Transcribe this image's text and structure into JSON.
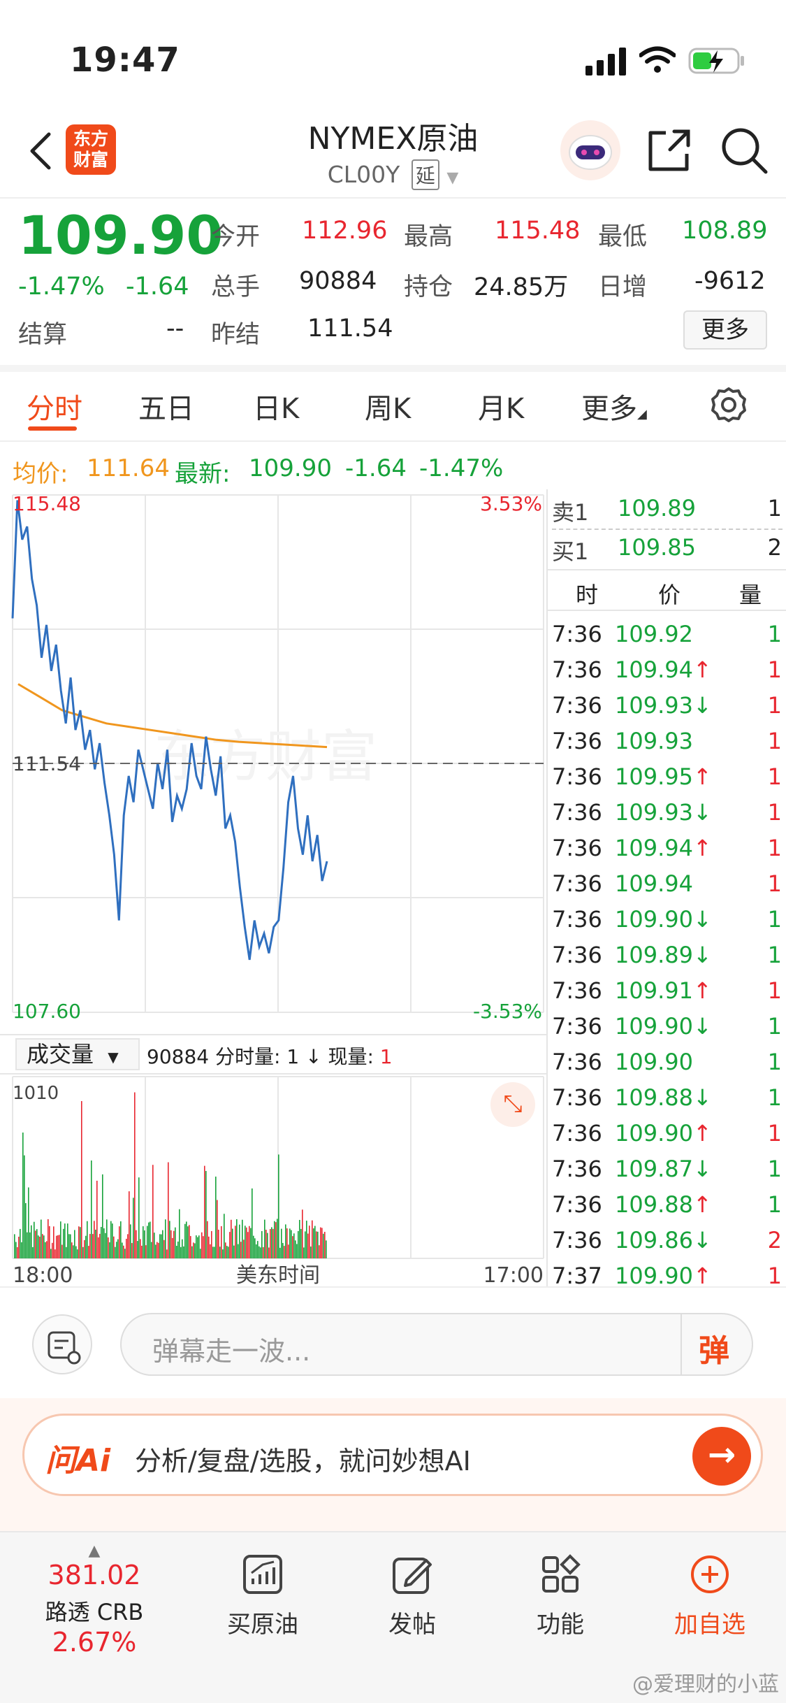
{
  "status": {
    "time": "19:47"
  },
  "header": {
    "logo_line1": "东方",
    "logo_line2": "财富",
    "title": "NYMEX原油",
    "code": "CL00Y",
    "delay_badge": "延"
  },
  "quote": {
    "price": "109.90",
    "change_pct": "-1.47%",
    "change": "-1.64",
    "settle_label": "结算",
    "settle_value": "--",
    "open_label": "今开",
    "open_value": "112.96",
    "high_label": "最高",
    "high_value": "115.48",
    "low_label": "最低",
    "low_value": "108.89",
    "volume_label": "总手",
    "volume_value": "90884",
    "oi_label": "持仓",
    "oi_value": "24.85万",
    "daily_inc_label": "日增",
    "daily_inc_value": "-9612",
    "prev_settle_label": "昨结",
    "prev_settle_value": "111.54",
    "more_label": "更多"
  },
  "tabs": [
    "分时",
    "五日",
    "日K",
    "周K",
    "月K",
    "更多"
  ],
  "avgbar": {
    "avg_label": "均价:",
    "avg_value": "111.64",
    "latest_label": "最新:",
    "latest_value": "109.90",
    "chg": "-1.64",
    "pct": "-1.47%"
  },
  "chart_data": {
    "type": "line",
    "ylim": [
      107.6,
      115.48
    ],
    "y_top_label": "115.48",
    "y_mid_label": "111.54",
    "y_bottom_label": "107.60",
    "pct_top_label": "3.53%",
    "pct_bottom_label": "-3.53%",
    "x_start_label": "18:00",
    "x_mid_label": "美东时间",
    "x_end_label": "17:00",
    "price_series": [
      113.6,
      115.4,
      114.8,
      115.0,
      114.2,
      113.8,
      113.0,
      113.5,
      112.8,
      113.2,
      112.5,
      112.0,
      112.7,
      111.9,
      112.2,
      111.6,
      111.9,
      111.3,
      111.7,
      111.1,
      110.6,
      110.0,
      109.0,
      110.6,
      111.2,
      110.8,
      111.6,
      111.3,
      111.0,
      110.7,
      111.4,
      111.0,
      111.6,
      110.5,
      110.9,
      110.7,
      111.0,
      111.7,
      111.2,
      111.0,
      111.8,
      111.3,
      110.9,
      111.5,
      110.4,
      110.6,
      110.2,
      109.5,
      108.9,
      108.4,
      109.0,
      108.6,
      108.8,
      108.5,
      108.9,
      109.0,
      109.8,
      110.8,
      111.2,
      110.4,
      110.0,
      110.6,
      109.9,
      110.3,
      109.6,
      109.9
    ],
    "avg_series": [
      112.6,
      112.4,
      112.2,
      112.1,
      112.0,
      111.95,
      111.9,
      111.85,
      111.8,
      111.75,
      111.72,
      111.7,
      111.68,
      111.66,
      111.64
    ],
    "volume": {
      "top_label": "1010",
      "selector_label": "成交量",
      "info_total": "90884",
      "info_time_vol_label": "分时量:",
      "info_time_vol": "1",
      "info_now_label": "现量:",
      "info_now": "1"
    }
  },
  "book": {
    "ask_label": "卖1",
    "ask_price": "109.89",
    "ask_vol": "1",
    "bid_label": "买1",
    "bid_price": "109.85",
    "bid_vol": "2",
    "col_time": "时",
    "col_price": "价",
    "col_vol": "量",
    "trades": [
      {
        "t": "7:36",
        "p": "109.92",
        "a": "",
        "v": "1",
        "vc": "green"
      },
      {
        "t": "7:36",
        "p": "109.94",
        "a": "↑",
        "v": "1",
        "vc": "red"
      },
      {
        "t": "7:36",
        "p": "109.93",
        "a": "↓",
        "v": "1",
        "vc": "red"
      },
      {
        "t": "7:36",
        "p": "109.93",
        "a": "",
        "v": "1",
        "vc": "red"
      },
      {
        "t": "7:36",
        "p": "109.95",
        "a": "↑",
        "v": "1",
        "vc": "red"
      },
      {
        "t": "7:36",
        "p": "109.93",
        "a": "↓",
        "v": "1",
        "vc": "red"
      },
      {
        "t": "7:36",
        "p": "109.94",
        "a": "↑",
        "v": "1",
        "vc": "red"
      },
      {
        "t": "7:36",
        "p": "109.94",
        "a": "",
        "v": "1",
        "vc": "red"
      },
      {
        "t": "7:36",
        "p": "109.90",
        "a": "↓",
        "v": "1",
        "vc": "green"
      },
      {
        "t": "7:36",
        "p": "109.89",
        "a": "↓",
        "v": "1",
        "vc": "green"
      },
      {
        "t": "7:36",
        "p": "109.91",
        "a": "↑",
        "v": "1",
        "vc": "red"
      },
      {
        "t": "7:36",
        "p": "109.90",
        "a": "↓",
        "v": "1",
        "vc": "green"
      },
      {
        "t": "7:36",
        "p": "109.90",
        "a": "",
        "v": "1",
        "vc": "green"
      },
      {
        "t": "7:36",
        "p": "109.88",
        "a": "↓",
        "v": "1",
        "vc": "green"
      },
      {
        "t": "7:36",
        "p": "109.90",
        "a": "↑",
        "v": "1",
        "vc": "red"
      },
      {
        "t": "7:36",
        "p": "109.87",
        "a": "↓",
        "v": "1",
        "vc": "green"
      },
      {
        "t": "7:36",
        "p": "109.88",
        "a": "↑",
        "v": "1",
        "vc": "green"
      },
      {
        "t": "7:36",
        "p": "109.86",
        "a": "↓",
        "v": "2",
        "vc": "red"
      },
      {
        "t": "7:37",
        "p": "109.90",
        "a": "↑",
        "v": "1",
        "vc": "red"
      }
    ]
  },
  "input": {
    "placeholder": "弹幕走一波...",
    "danmu_label": "弹"
  },
  "ai": {
    "brand": "问Ai",
    "text": "分析/复盘/选股，就问妙想AI"
  },
  "tabbar": {
    "index_value": "381.02",
    "index_name": "路透 CRB",
    "index_pct": "2.67%",
    "buy_label": "买原油",
    "post_label": "发帖",
    "func_label": "功能",
    "add_label": "加自选"
  },
  "watermark": "@爱理财的小蓝",
  "colors": {
    "up": "#e8262f",
    "down": "#16a23a",
    "accent": "#f04a1a",
    "price_line": "#2f6fbf",
    "avg_line": "#f0961e"
  }
}
